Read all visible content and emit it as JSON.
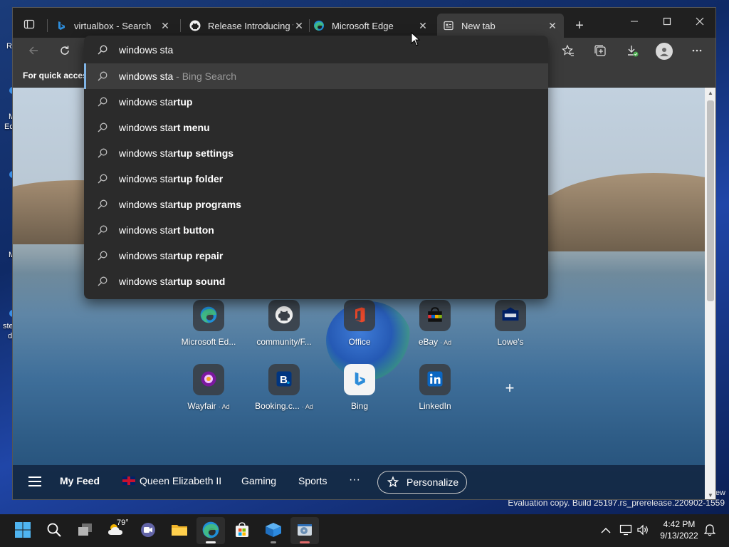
{
  "desktop": {
    "fragments": [
      "Re",
      "M",
      "Ed",
      "M",
      "ste",
      "d"
    ],
    "watermark": "Evaluation copy. Build 25197.rs_prerelease.220902-1559",
    "right_fragment": "ew"
  },
  "browser": {
    "tabs": [
      {
        "title": "virtualbox - Search",
        "icon": "bing-icon",
        "active": false
      },
      {
        "title": "Release Introducing v",
        "icon": "github-icon",
        "active": false
      },
      {
        "title": "Microsoft Edge",
        "icon": "edge-icon",
        "active": false
      },
      {
        "title": "New tab",
        "icon": "newtab-icon",
        "active": true
      }
    ],
    "newtab_label": "+",
    "favorites_bar_message": "For quick access"
  },
  "omnibox": {
    "query": "windows sta",
    "suggestions": [
      {
        "typed": "windows sta",
        "rest": "",
        "suffix": " - Bing Search",
        "selected": true
      },
      {
        "typed": "windows sta",
        "rest": "rtup",
        "suffix": ""
      },
      {
        "typed": "windows sta",
        "rest": "rt menu",
        "suffix": ""
      },
      {
        "typed": "windows sta",
        "rest": "rtup settings",
        "suffix": ""
      },
      {
        "typed": "windows sta",
        "rest": "rtup folder",
        "suffix": ""
      },
      {
        "typed": "windows sta",
        "rest": "rtup programs",
        "suffix": ""
      },
      {
        "typed": "windows sta",
        "rest": "rt button",
        "suffix": ""
      },
      {
        "typed": "windows sta",
        "rest": "rtup repair",
        "suffix": ""
      },
      {
        "typed": "windows sta",
        "rest": "rtup sound",
        "suffix": ""
      }
    ]
  },
  "quick_links": [
    {
      "label": "Microsoft Ed...",
      "ad": "",
      "icon": "edge-icon"
    },
    {
      "label": "community/F...",
      "ad": "",
      "icon": "github-icon"
    },
    {
      "label": "Office",
      "ad": "",
      "icon": "office-icon"
    },
    {
      "label": "eBay",
      "ad": "Ad",
      "icon": "ebay-icon"
    },
    {
      "label": "Lowe's",
      "ad": "",
      "icon": "lowes-icon"
    },
    {
      "label": "Wayfair",
      "ad": "Ad",
      "icon": "wayfair-icon"
    },
    {
      "label": "Booking.c...",
      "ad": "Ad",
      "icon": "booking-icon"
    },
    {
      "label": "Bing",
      "ad": "",
      "icon": "bing-icon"
    },
    {
      "label": "LinkedIn",
      "ad": "",
      "icon": "linkedin-icon"
    }
  ],
  "add_tile_label": "+",
  "feed": {
    "my_feed": "My Feed",
    "topics": [
      "Queen Elizabeth II",
      "Gaming",
      "Sports"
    ],
    "more": "···",
    "personalize": "Personalize"
  },
  "taskbar": {
    "weather_temp": "79°",
    "time": "4:42 PM",
    "date": "9/13/2022"
  },
  "colors": {
    "accent": "#7fb4e6",
    "tab_active": "#3b3b3b",
    "dropdown_bg": "#2b2b2b"
  }
}
